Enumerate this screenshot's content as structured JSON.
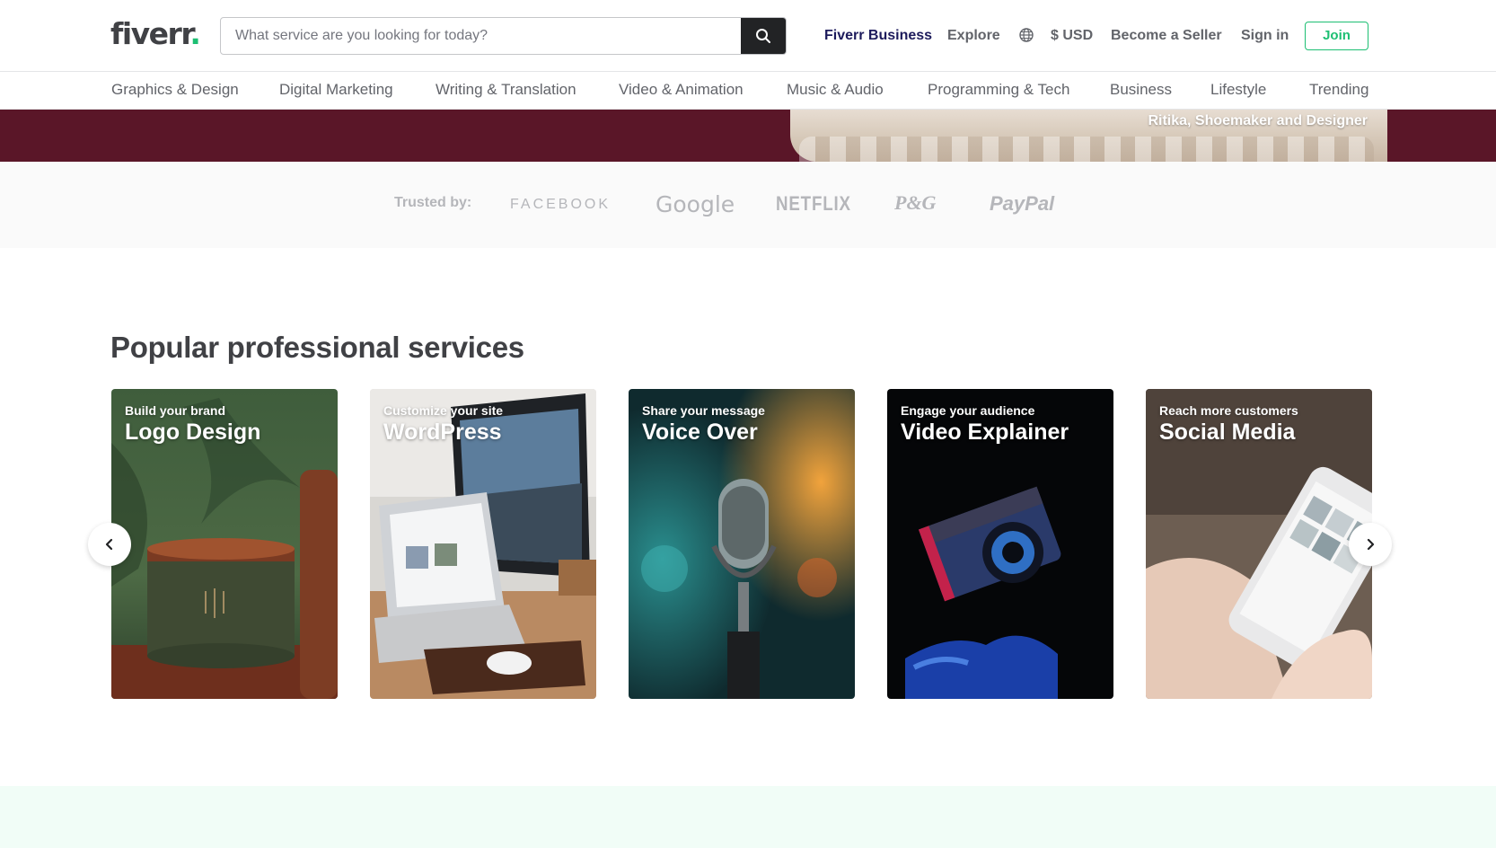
{
  "header": {
    "logo_text": "fiverr",
    "logo_dot": ".",
    "search_placeholder": "What service are you looking for today?",
    "nav": {
      "business": "Fiverr Business",
      "explore": "Explore",
      "currency": "$ USD",
      "become_seller": "Become a Seller",
      "sign_in": "Sign in",
      "join": "Join"
    }
  },
  "categories": [
    "Graphics & Design",
    "Digital Marketing",
    "Writing & Translation",
    "Video & Animation",
    "Music & Audio",
    "Programming & Tech",
    "Business",
    "Lifestyle",
    "Trending"
  ],
  "hero": {
    "caption": "Ritika, Shoemaker and Designer"
  },
  "trusted": {
    "label": "Trusted by:",
    "brands": [
      "FACEBOOK",
      "Google",
      "NETFLIX",
      "P&G",
      "PayPal"
    ]
  },
  "popular": {
    "title": "Popular professional services",
    "cards": [
      {
        "subtitle": "Build your brand",
        "title": "Logo Design"
      },
      {
        "subtitle": "Customize your site",
        "title": "WordPress"
      },
      {
        "subtitle": "Share your message",
        "title": "Voice Over"
      },
      {
        "subtitle": "Engage your audience",
        "title": "Video Explainer"
      },
      {
        "subtitle": "Reach more customers",
        "title": "Social Media"
      }
    ]
  },
  "colors": {
    "brand_green": "#1dbf73",
    "hero_bg": "#5a1628",
    "business_navy": "#1d1b5c"
  }
}
